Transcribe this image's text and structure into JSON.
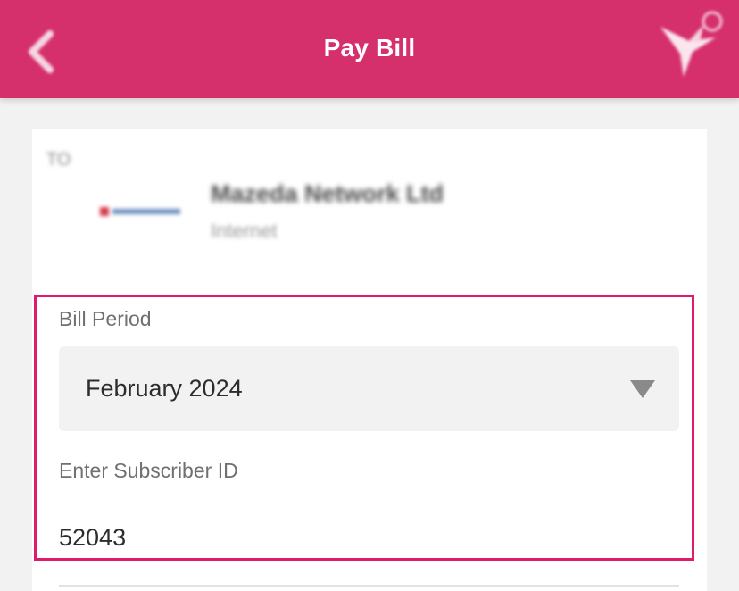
{
  "header": {
    "title": "Pay Bill",
    "background_color": "#d6306c",
    "back_icon": "chevron-left-icon",
    "brand_icon": "bird-logo-icon"
  },
  "recipient": {
    "to_label": "TO",
    "biller_name": "Mazeda Network Ltd",
    "biller_category": "Internet",
    "biller_logo_icon": "biller-logo-icon"
  },
  "form": {
    "bill_period": {
      "label": "Bill Period",
      "selected": "February 2024",
      "caret_icon": "caret-down-icon"
    },
    "subscriber_id": {
      "label": "Enter Subscriber ID",
      "value": "52043"
    },
    "highlight_color": "#e01a6c"
  }
}
